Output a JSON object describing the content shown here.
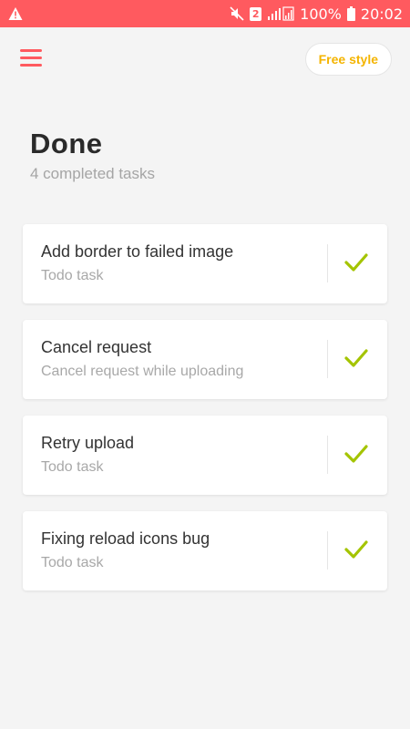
{
  "status_bar": {
    "battery": "100%",
    "time": "20:02",
    "sim": "2"
  },
  "header": {
    "menu_icon": "hamburger-menu-icon",
    "style_button": "Free style"
  },
  "page": {
    "title": "Done",
    "subtitle": "4 completed tasks"
  },
  "tasks": [
    {
      "title": "Add border to failed image",
      "subtitle": "Todo task"
    },
    {
      "title": "Cancel request",
      "subtitle": "Cancel request while uploading"
    },
    {
      "title": "Retry upload",
      "subtitle": "Todo task"
    },
    {
      "title": "Fixing reload icons bug",
      "subtitle": "Todo task"
    }
  ],
  "colors": {
    "accent": "#ff5a5f",
    "style_button_text": "#f4b400",
    "check": "#a4c400"
  }
}
